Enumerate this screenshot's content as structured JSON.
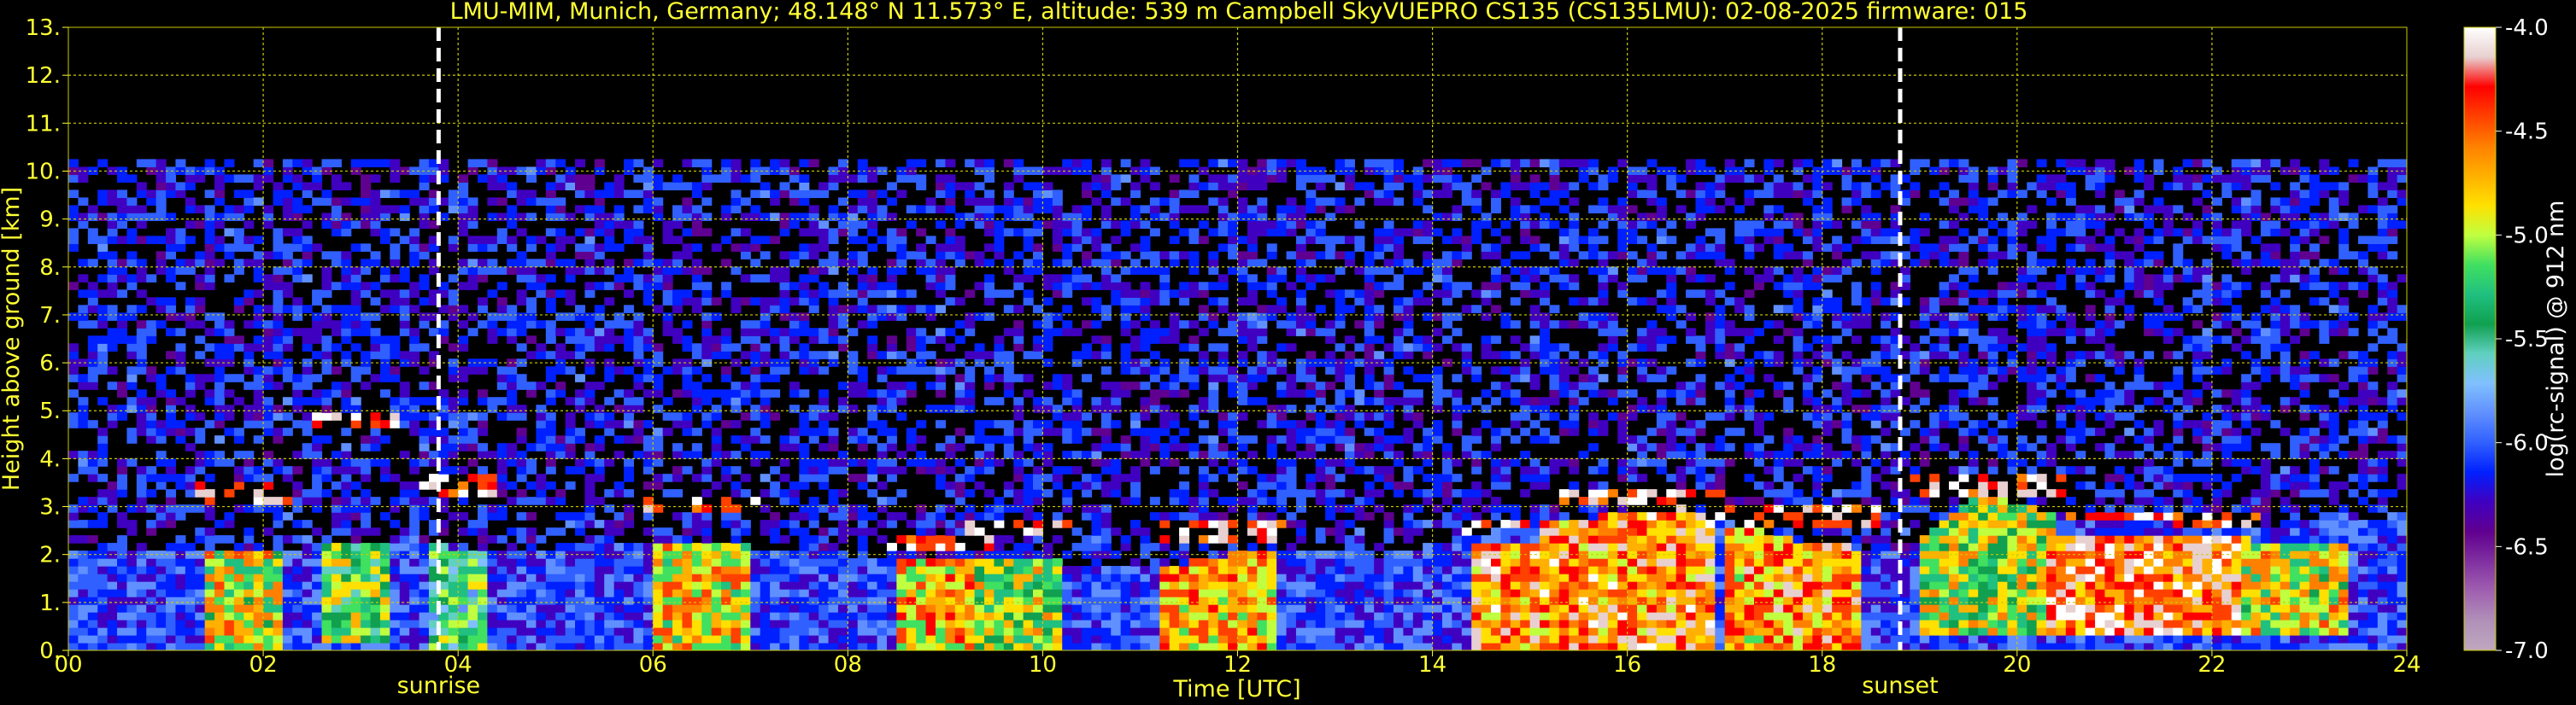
{
  "colors": {
    "background": "#000000",
    "text": "#ffff33",
    "grid": "#cccc00",
    "marker": "#ffffff"
  },
  "chart_data": {
    "type": "heatmap",
    "title": "LMU-MIM, Munich, Germany; 48.148° N 11.573° E, altitude: 539 m    Campbell SkyVUEPRO CS135 (CS135LMU): 02-08-2025    firmware: 015",
    "xlabel": "Time [UTC]",
    "ylabel": "Height above ground [km]",
    "xlim": [
      0,
      24
    ],
    "ylim": [
      0,
      13
    ],
    "x_ticks": [
      "00",
      "02",
      "04",
      "06",
      "08",
      "10",
      "12",
      "14",
      "16",
      "18",
      "20",
      "22",
      "24"
    ],
    "y_ticks": [
      "0.",
      "1.",
      "2.",
      "3.",
      "4.",
      "5.",
      "6.",
      "7.",
      "8.",
      "9.",
      "10.",
      "11.",
      "12.",
      "13."
    ],
    "grid": true,
    "data_top_km": 10.25,
    "events": [
      {
        "label": "sunrise",
        "time_utc": 3.8
      },
      {
        "label": "sunset",
        "time_utc": 18.8
      }
    ],
    "colorbar": {
      "label": "log(rc-signal) @ 912 nm",
      "range": [
        -7.0,
        -4.0
      ],
      "ticks": [
        "-4.0",
        "-4.5",
        "-5.0",
        "-5.5",
        "-6.0",
        "-6.5",
        "-7.0"
      ],
      "colors": [
        "#ffffff",
        "#e8d0d0",
        "#ff0000",
        "#ff4000",
        "#ff8000",
        "#ffb000",
        "#ffe000",
        "#c0ff40",
        "#40e060",
        "#20c080",
        "#10a050",
        "#60d0c0",
        "#80c0ff",
        "#6090ff",
        "#3060ff",
        "#0020ff",
        "#4000c0",
        "#600090",
        "#8030a0",
        "#a060b0",
        "#b090b8",
        "#c0a8c0"
      ]
    },
    "boundary_layer": [
      {
        "t": 0.0,
        "top": 2.0
      },
      {
        "t": 1.5,
        "top": 2.0
      },
      {
        "t": 2.5,
        "top": 2.1
      },
      {
        "t": 3.5,
        "top": 2.3
      },
      {
        "t": 4.0,
        "top": 2.0
      },
      {
        "t": 5.5,
        "top": 2.1
      },
      {
        "t": 6.5,
        "top": 2.2
      },
      {
        "t": 8.0,
        "top": 1.8
      },
      {
        "t": 9.5,
        "top": 1.9
      },
      {
        "t": 11.0,
        "top": 1.6
      },
      {
        "t": 12.0,
        "top": 2.0
      },
      {
        "t": 13.5,
        "top": 1.9
      },
      {
        "t": 15.0,
        "top": 2.6
      },
      {
        "t": 16.5,
        "top": 2.9
      },
      {
        "t": 17.5,
        "top": 2.3
      },
      {
        "t": 18.8,
        "top": 1.9
      },
      {
        "t": 19.5,
        "top": 3.2
      },
      {
        "t": 20.5,
        "top": 2.7
      },
      {
        "t": 22.0,
        "top": 2.5
      },
      {
        "t": 24.0,
        "top": 2.7
      }
    ],
    "high_signal_regions": [
      {
        "t0": 1.4,
        "t1": 2.1,
        "h0": 0.0,
        "h1": 3.0,
        "level": -4.8
      },
      {
        "t0": 2.6,
        "t1": 3.3,
        "h0": 0.1,
        "h1": 4.5,
        "level": -5.0
      },
      {
        "t0": 3.7,
        "t1": 4.2,
        "h0": 0.0,
        "h1": 3.2,
        "level": -5.2
      },
      {
        "t0": 6.0,
        "t1": 6.9,
        "h0": 0.0,
        "h1": 2.8,
        "level": -4.7
      },
      {
        "t0": 8.5,
        "t1": 9.3,
        "h0": 0.0,
        "h1": 2.0,
        "level": -4.6
      },
      {
        "t0": 9.3,
        "t1": 10.2,
        "h0": 0.0,
        "h1": 2.3,
        "level": -4.9
      },
      {
        "t0": 11.2,
        "t1": 12.3,
        "h0": 0.0,
        "h1": 2.2,
        "level": -4.6
      },
      {
        "t0": 14.4,
        "t1": 15.1,
        "h0": 0.0,
        "h1": 2.2,
        "level": -4.4
      },
      {
        "t0": 15.1,
        "t1": 16.8,
        "h0": 0.0,
        "h1": 2.9,
        "level": -4.4
      },
      {
        "t0": 17.0,
        "t1": 18.4,
        "h0": 0.0,
        "h1": 2.5,
        "level": -4.5
      },
      {
        "t0": 19.0,
        "t1": 20.3,
        "h0": 0.2,
        "h1": 3.2,
        "level": -4.9
      },
      {
        "t0": 20.3,
        "t1": 22.3,
        "h0": 0.2,
        "h1": 2.4,
        "level": -4.3
      },
      {
        "t0": 22.3,
        "t1": 23.3,
        "h0": 0.2,
        "h1": 2.1,
        "level": -4.8
      }
    ]
  }
}
